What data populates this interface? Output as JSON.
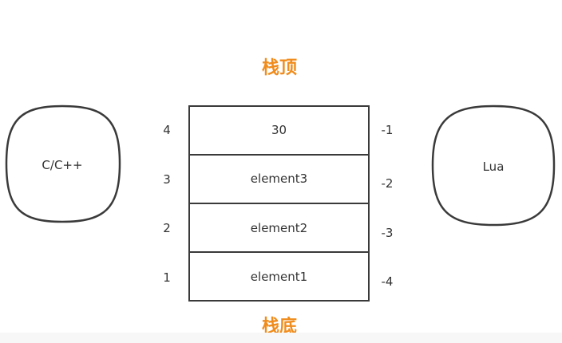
{
  "stack": {
    "top_label": "栈顶",
    "bottom_label": "栈底",
    "cells": [
      "30",
      "element3",
      "element2",
      "element1"
    ],
    "positive_indices": [
      "4",
      "3",
      "2",
      "1"
    ],
    "negative_indices": [
      "-1",
      "-2",
      "-3",
      "-4"
    ]
  },
  "left_node": {
    "label": "C/C++"
  },
  "right_node": {
    "label": "Lua"
  },
  "colors": {
    "accent": "#f08c1c",
    "stroke": "#3a3a3a",
    "text": "#333333"
  }
}
